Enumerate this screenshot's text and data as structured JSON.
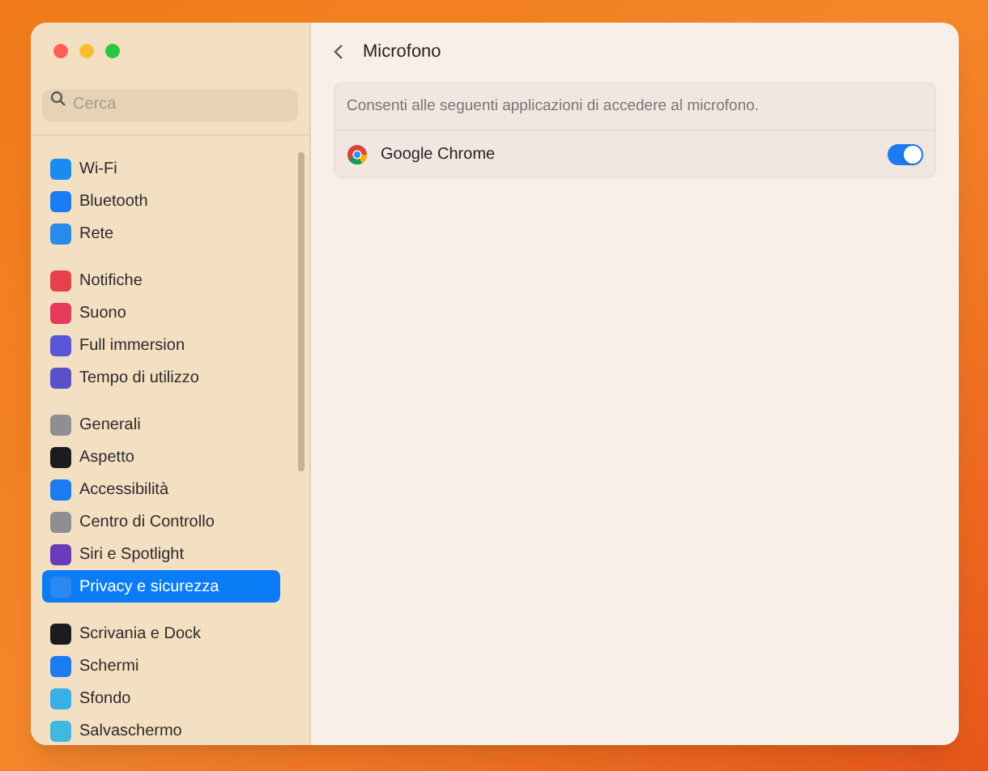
{
  "search": {
    "placeholder": "Cerca"
  },
  "sidebar": {
    "groups": [
      {
        "items": [
          {
            "label": "Wi-Fi",
            "color": "#1a8cf0",
            "selected": false
          },
          {
            "label": "Bluetooth",
            "color": "#1a7cf0",
            "selected": false
          },
          {
            "label": "Rete",
            "color": "#2a8ae8",
            "selected": false
          }
        ]
      },
      {
        "items": [
          {
            "label": "Notifiche",
            "color": "#e8404a",
            "selected": false
          },
          {
            "label": "Suono",
            "color": "#e83a5a",
            "selected": false
          },
          {
            "label": "Full immersion",
            "color": "#5a54d8",
            "selected": false
          },
          {
            "label": "Tempo di utilizzo",
            "color": "#5a50c8",
            "selected": false
          }
        ]
      },
      {
        "items": [
          {
            "label": "Generali",
            "color": "#8e8e93",
            "selected": false
          },
          {
            "label": "Aspetto",
            "color": "#1c1c1e",
            "selected": false
          },
          {
            "label": "Accessibilità",
            "color": "#1a7cf0",
            "selected": false
          },
          {
            "label": "Centro di Controllo",
            "color": "#8e8e93",
            "selected": false
          },
          {
            "label": "Siri e Spotlight",
            "color": "#6a3ab8",
            "selected": false
          },
          {
            "label": "Privacy e sicurezza",
            "color": "#2a88f0",
            "selected": true
          }
        ]
      },
      {
        "items": [
          {
            "label": "Scrivania e Dock",
            "color": "#1c1c1e",
            "selected": false
          },
          {
            "label": "Schermi",
            "color": "#1a7cf0",
            "selected": false
          },
          {
            "label": "Sfondo",
            "color": "#3ab0e8",
            "selected": false
          },
          {
            "label": "Salvaschermo",
            "color": "#40b8e0",
            "selected": false
          }
        ]
      }
    ]
  },
  "header": {
    "title": "Microfono"
  },
  "panel": {
    "description": "Consenti alle seguenti applicazioni di accedere al microfono.",
    "apps": [
      {
        "name": "Google Chrome",
        "on": true
      }
    ]
  }
}
